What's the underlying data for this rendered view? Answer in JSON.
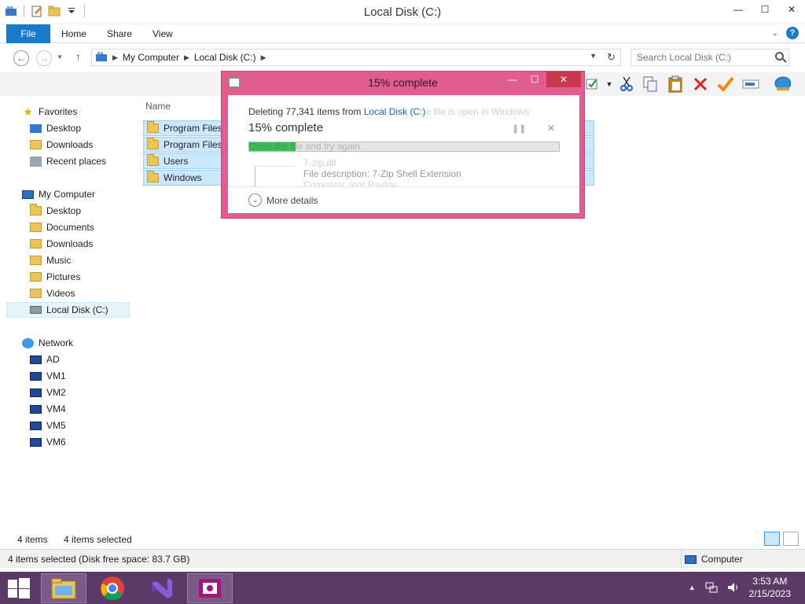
{
  "window": {
    "title": "Local Disk (C:)",
    "controls": {
      "minimize": "—",
      "maximize": "☐",
      "close": "✕"
    }
  },
  "ribbon": {
    "tabs": [
      "File",
      "Home",
      "Share",
      "View"
    ]
  },
  "address": {
    "crumbs": [
      "My Computer",
      "Local Disk (C:)"
    ],
    "search_placeholder": "Search Local Disk (C:)"
  },
  "toolbar": {
    "icons": [
      "properties-icon",
      "cut-icon",
      "copy-icon",
      "paste-icon",
      "delete-icon",
      "rename-icon",
      "select-icon",
      "network-icon"
    ]
  },
  "navpane": {
    "favorites_header": "Favorites",
    "favorites": [
      "Desktop",
      "Downloads",
      "Recent places"
    ],
    "computer_header": "My Computer",
    "computer": [
      "Desktop",
      "Documents",
      "Downloads",
      "Music",
      "Pictures",
      "Videos",
      "Local Disk (C:)"
    ],
    "network_header": "Network",
    "network": [
      "AD",
      "VM1",
      "VM2",
      "VM4",
      "VM5",
      "VM6"
    ]
  },
  "filelist": {
    "column_name": "Name",
    "rows": [
      "Program Files",
      "Program Files",
      "Users",
      "Windows"
    ]
  },
  "status": {
    "item_count": "4 items",
    "selected_count": "4 items selected",
    "details": "4 items selected (Disk free space: 83.7 GB)",
    "location": "Computer"
  },
  "dialog": {
    "title": "15% complete",
    "line_prefix": "Deleting 77,341 items from ",
    "line_location": "Local Disk (C:)",
    "line_ghost": "e file is open in Windows",
    "percent_text": "15% complete",
    "progress": 0.15,
    "ghost_retry": "Close the file and try again.",
    "file_name": "7-zip.dll",
    "file_description": "File description: 7-Zip Shell Extension",
    "company": "Company: Igor Pavlov",
    "more_details": "More details"
  },
  "taskbar": {
    "time": "3:53 AM",
    "date": "2/15/2023"
  }
}
